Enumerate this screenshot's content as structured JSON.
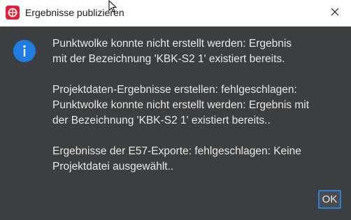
{
  "window": {
    "title": "Ergebnisse publizieren",
    "app_icon": "app-logo-icon",
    "close_icon": "close-icon"
  },
  "dialog": {
    "icon": "info-icon",
    "icon_color": "#1f7ce0",
    "messages": [
      " Punktwolke konnte nicht erstellt werden: Ergebnis\nmit der Bezeichnung 'KBK-S2 1' existiert bereits.",
      "Projektdaten-Ergebnisse erstellen: fehlgeschlagen:\nPunktwolke konnte nicht erstellt werden: Ergebnis mit\nder Bezeichnung 'KBK-S2 1' existiert bereits..",
      "Ergebnisse der E57-Exporte: fehlgeschlagen: Keine\nProjektdatei ausgewählt.."
    ],
    "ok_label": "OK"
  }
}
